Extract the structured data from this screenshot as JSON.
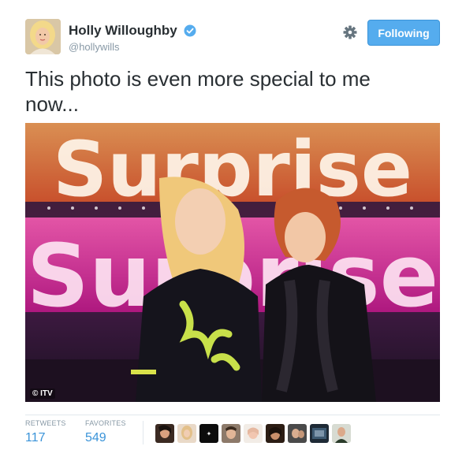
{
  "user": {
    "fullname": "Holly Willoughby",
    "username": "@hollywills",
    "verified": true
  },
  "actions": {
    "gear_icon": "gear-icon",
    "follow_label": "Following"
  },
  "tweet": {
    "text": "This photo is even more special to me now..."
  },
  "photo": {
    "credit": "© ITV",
    "sign_top": "Surprise",
    "sign_bottom": "Surprise"
  },
  "stats": {
    "retweets_label": "RETWEETS",
    "retweets_value": "117",
    "favorites_label": "FAVORITES",
    "favorites_value": "549"
  },
  "favoriters_count_shown": 9,
  "colors": {
    "accent": "#55acee",
    "link": "#3b94d9",
    "muted": "#8899a6",
    "text": "#292f33"
  }
}
